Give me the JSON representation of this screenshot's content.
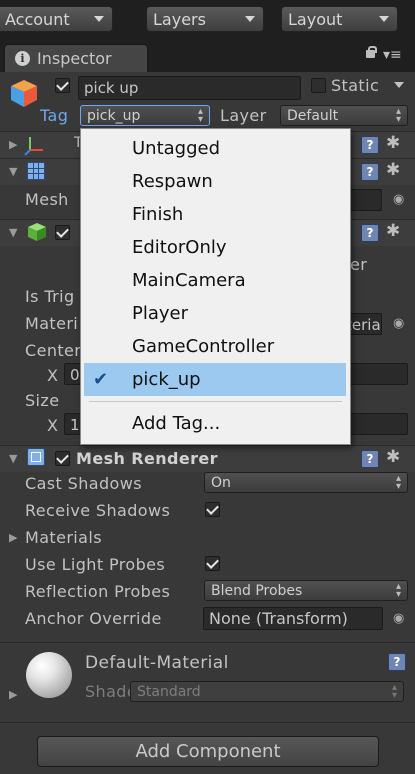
{
  "toolbar": {
    "account_label": "Account",
    "layers_label": "Layers",
    "layout_label": "Layout"
  },
  "tab": {
    "inspector_label": "Inspector"
  },
  "object": {
    "name": "pick up",
    "static_label": "Static",
    "tag_label": "Tag",
    "tag_value": "pick_up",
    "layer_label": "Layer",
    "layer_value": "Default"
  },
  "fragments": {
    "t": "T",
    "mesh": "Mesh",
    "is_trig": "Is Trig",
    "materi": "Materi",
    "center": "Center",
    "size": "Size",
    "x1": "X",
    "x1_val": "0",
    "x2": "X",
    "x2_val": "1",
    "er": "er",
    "teria": "teria"
  },
  "tag_menu": {
    "items": [
      "Untagged",
      "Respawn",
      "Finish",
      "EditorOnly",
      "MainCamera",
      "Player",
      "GameController",
      "pick_up"
    ],
    "selected": "pick_up",
    "add_tag": "Add Tag..."
  },
  "mesh_renderer": {
    "title": "Mesh Renderer",
    "cast_shadows_label": "Cast Shadows",
    "cast_shadows_value": "On",
    "receive_shadows_label": "Receive Shadows",
    "materials_label": "Materials",
    "use_light_probes_label": "Use Light Probes",
    "reflection_probes_label": "Reflection Probes",
    "reflection_probes_value": "Blend Probes",
    "anchor_override_label": "Anchor Override",
    "anchor_override_value": "None (Transform)"
  },
  "material": {
    "name": "Default-Material",
    "shader_label": "Shader",
    "shader_value": "Standard"
  },
  "add_component_label": "Add Component",
  "icons": [
    "info-icon",
    "lock-icon",
    "menu-icon",
    "cube-icon",
    "transform-axis-icon",
    "grid-icon",
    "green-cube-icon",
    "mesh-renderer-icon",
    "help-icon",
    "gear-icon",
    "sphere-preview-icon",
    "checkmark-icon",
    "object-picker-icon"
  ],
  "colors": {
    "accent_blue": "#6fa8e8",
    "selection": "#9cc9ef",
    "panel": "#383838"
  }
}
